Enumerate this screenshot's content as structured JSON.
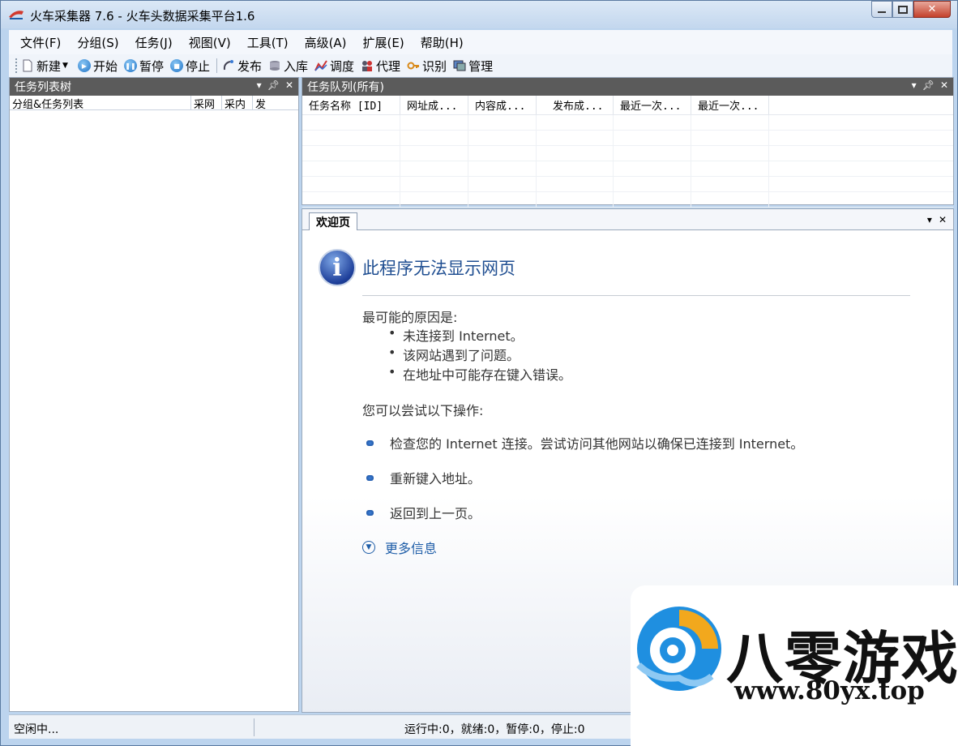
{
  "window": {
    "title": "火车采集器 7.6 - 火车头数据采集平台1.6",
    "close_glyph": "✕"
  },
  "menu": [
    "文件(F)",
    "分组(S)",
    "任务(J)",
    "视图(V)",
    "工具(T)",
    "高级(A)",
    "扩展(E)",
    "帮助(H)"
  ],
  "toolbar": {
    "new": "新建",
    "start": "开始",
    "pause": "暂停",
    "stop": "停止",
    "publish": "发布",
    "import": "入库",
    "schedule": "调度",
    "proxy": "代理",
    "recognize": "识别",
    "manage": "管理"
  },
  "task_tree": {
    "title": "任务列表树",
    "columns": [
      "分组&任务列表",
      "采网",
      "采内",
      "发"
    ]
  },
  "queue": {
    "title": "任务队列(所有)",
    "columns": [
      "任务名称 [ID]",
      "网址成...",
      "内容成...",
      "发布成...",
      "最近一次...",
      "最近一次..."
    ]
  },
  "welcome": {
    "tab_label": "欢迎页",
    "error_title": "此程序无法显示网页",
    "cause_label": "最可能的原因是:",
    "causes": [
      "未连接到 Internet。",
      "该网站遇到了问题。",
      "在地址中可能存在键入错误。"
    ],
    "try_label": "您可以尝试以下操作:",
    "actions": [
      "检查您的 Internet 连接。尝试访问其他网站以确保已连接到 Internet。",
      "重新键入地址。",
      "返回到上一页。"
    ],
    "more_info": "更多信息"
  },
  "status": {
    "left": "空闲中...",
    "counts": "运行中:0，就绪:0，暂停:0，停止:0"
  },
  "watermark": {
    "brand": "八零游戏",
    "url": "www.80yx.top"
  },
  "colors": {
    "panel_header": "#5b5b5b",
    "accent_blue": "#1f4e91",
    "link_blue": "#1f5ea8"
  }
}
